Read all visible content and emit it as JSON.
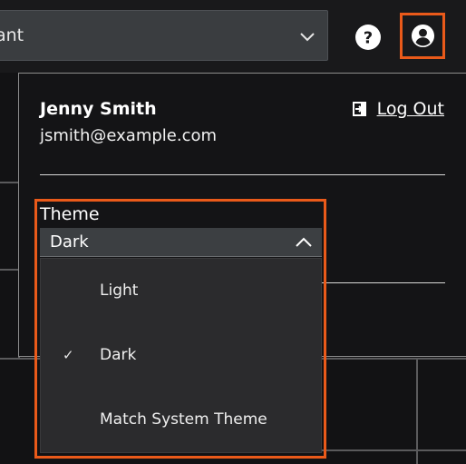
{
  "header": {
    "tenant_select_value": "ant",
    "chevron_icon": "chevron-down-icon",
    "help_icon": "help-circle-icon",
    "profile_icon": "user-avatar-icon"
  },
  "profile_menu": {
    "user_name": "Jenny Smith",
    "user_email": "jsmith@example.com",
    "logout_label": "Log Out",
    "logout_icon": "logout-arrow-icon"
  },
  "theme": {
    "label": "Theme",
    "selected": "Dark",
    "options": [
      {
        "label": "Light",
        "checked": false
      },
      {
        "label": "Dark",
        "checked": true
      },
      {
        "label": "Match System Theme",
        "checked": false
      }
    ],
    "check_mark": "✓"
  },
  "colors": {
    "highlight": "#ea5a1a",
    "panel_bg": "#141416",
    "select_bg": "#3c3f42",
    "menu_bg": "#2b2b2d"
  }
}
